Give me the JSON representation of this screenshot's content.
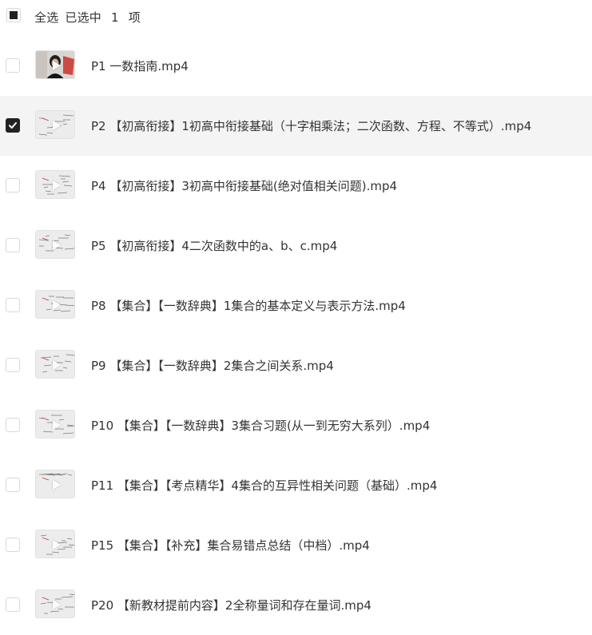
{
  "header": {
    "select_all_label": "全选",
    "selected_prefix": "已选中",
    "selected_count": "1",
    "selected_unit": "项"
  },
  "items": [
    {
      "title": "P1 一数指南.mp4",
      "checked": false,
      "thumb": "person"
    },
    {
      "title": "P2 【初高衔接】1初高中衔接基础（十字相乘法；二次函数、方程、不等式）.mp4",
      "checked": true,
      "thumb": "notes"
    },
    {
      "title": "P4 【初高衔接】3初高中衔接基础(绝对值相关问题).mp4",
      "checked": false,
      "thumb": "notes"
    },
    {
      "title": "P5 【初高衔接】4二次函数中的a、b、c.mp4",
      "checked": false,
      "thumb": "notes"
    },
    {
      "title": "P8 【集合】【一数辞典】1集合的基本定义与表示方法.mp4",
      "checked": false,
      "thumb": "notes"
    },
    {
      "title": "P9 【集合】【一数辞典】2集合之间关系.mp4",
      "checked": false,
      "thumb": "notes"
    },
    {
      "title": "P10 【集合】【一数辞典】3集合习题(从一到无穷大系列）.mp4",
      "checked": false,
      "thumb": "notes"
    },
    {
      "title": "P11 【集合】【考点精华】4集合的互异性相关问题（基础）.mp4",
      "checked": false,
      "thumb": "notes"
    },
    {
      "title": "P15 【集合】【补充】集合易错点总结（中档）.mp4",
      "checked": false,
      "thumb": "notes"
    },
    {
      "title": "P20 【新教材提前内容】2全称量词和存在量词.mp4",
      "checked": false,
      "thumb": "notes"
    }
  ]
}
